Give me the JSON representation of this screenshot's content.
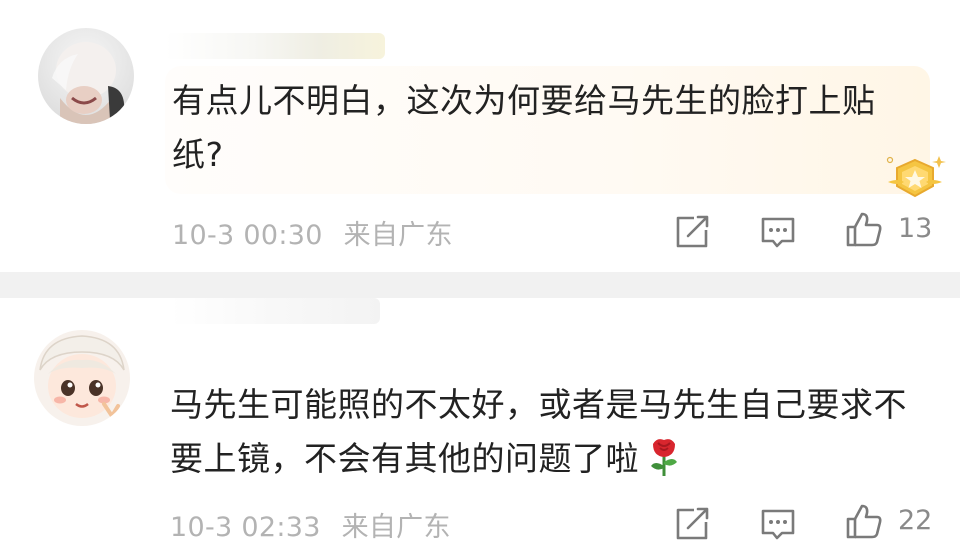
{
  "comments": [
    {
      "text": "有点儿不明白，这次为何要给马先生的脸打上贴纸?",
      "time": "10-3 00:30",
      "location": "来自广东",
      "likes": "13"
    },
    {
      "text": "马先生可能照的不太好，或者是马先生自己要求不要上镜，不会有其他的问题了啦",
      "time": "10-3 02:33",
      "location": "来自广东",
      "likes": "22"
    }
  ],
  "icons": {
    "share": "share-icon",
    "comment": "comment-icon",
    "like": "thumbs-up-icon",
    "badge": "fan-badge-icon",
    "rose": "rose-emoji-icon"
  }
}
